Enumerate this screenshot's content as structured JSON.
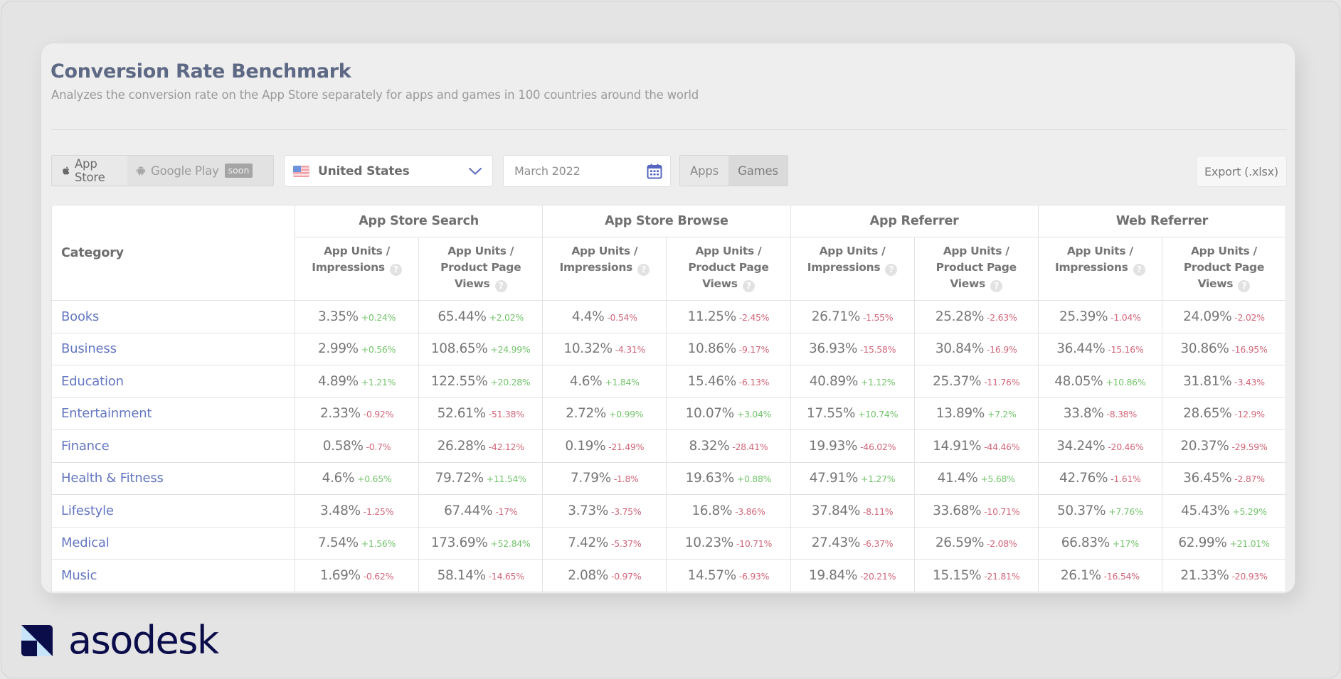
{
  "header": {
    "title": "Conversion Rate Benchmark",
    "subtitle": "Analyzes the conversion rate on the App Store separately for apps and games in 100 countries around the world"
  },
  "controls": {
    "store_options": [
      {
        "label": "App Store",
        "icon": "apple-icon",
        "active": true
      },
      {
        "label": "Google Play",
        "icon": "android-icon",
        "active": false,
        "badge": "soon"
      }
    ],
    "country": {
      "label": "United States",
      "flag": "us-flag-icon"
    },
    "date": {
      "value": "March 2022",
      "icon": "calendar-icon"
    },
    "type_options": [
      {
        "label": "Apps",
        "active": true
      },
      {
        "label": "Games",
        "active": false
      }
    ],
    "export_label": "Export (.xlsx)"
  },
  "table": {
    "category_header": "Category",
    "groups": [
      "App Store Search",
      "App Store Browse",
      "App Referrer",
      "Web Referrer"
    ],
    "sub_headers": {
      "impressions": [
        "App Units /",
        "Impressions"
      ],
      "ppv": [
        "App Units /",
        "Product Page",
        "Views"
      ]
    },
    "help_glyph": "?",
    "rows": [
      {
        "category": "Books",
        "cells": [
          {
            "v": "3.35%",
            "d": "+0.24%"
          },
          {
            "v": "65.44%",
            "d": "+2.02%"
          },
          {
            "v": "4.4%",
            "d": "-0.54%"
          },
          {
            "v": "11.25%",
            "d": "-2.45%"
          },
          {
            "v": "26.71%",
            "d": "-1.55%"
          },
          {
            "v": "25.28%",
            "d": "-2.63%"
          },
          {
            "v": "25.39%",
            "d": "-1.04%"
          },
          {
            "v": "24.09%",
            "d": "-2.02%"
          }
        ]
      },
      {
        "category": "Business",
        "cells": [
          {
            "v": "2.99%",
            "d": "+0.56%"
          },
          {
            "v": "108.65%",
            "d": "+24.99%"
          },
          {
            "v": "10.32%",
            "d": "-4.31%"
          },
          {
            "v": "10.86%",
            "d": "-9.17%"
          },
          {
            "v": "36.93%",
            "d": "-15.58%"
          },
          {
            "v": "30.84%",
            "d": "-16.9%"
          },
          {
            "v": "36.44%",
            "d": "-15.16%"
          },
          {
            "v": "30.86%",
            "d": "-16.95%"
          }
        ]
      },
      {
        "category": "Education",
        "cells": [
          {
            "v": "4.89%",
            "d": "+1.21%"
          },
          {
            "v": "122.55%",
            "d": "+20.28%"
          },
          {
            "v": "4.6%",
            "d": "+1.84%"
          },
          {
            "v": "15.46%",
            "d": "-6.13%"
          },
          {
            "v": "40.89%",
            "d": "+1.12%"
          },
          {
            "v": "25.37%",
            "d": "-11.76%"
          },
          {
            "v": "48.05%",
            "d": "+10.86%"
          },
          {
            "v": "31.81%",
            "d": "-3.43%"
          }
        ]
      },
      {
        "category": "Entertainment",
        "cells": [
          {
            "v": "2.33%",
            "d": "-0.92%"
          },
          {
            "v": "52.61%",
            "d": "-51.38%"
          },
          {
            "v": "2.72%",
            "d": "+0.99%"
          },
          {
            "v": "10.07%",
            "d": "+3.04%"
          },
          {
            "v": "17.55%",
            "d": "+10.74%"
          },
          {
            "v": "13.89%",
            "d": "+7.2%"
          },
          {
            "v": "33.8%",
            "d": "-8.38%"
          },
          {
            "v": "28.65%",
            "d": "-12.9%"
          }
        ]
      },
      {
        "category": "Finance",
        "cells": [
          {
            "v": "0.58%",
            "d": "-0.7%"
          },
          {
            "v": "26.28%",
            "d": "-42.12%"
          },
          {
            "v": "0.19%",
            "d": "-21.49%"
          },
          {
            "v": "8.32%",
            "d": "-28.41%"
          },
          {
            "v": "19.93%",
            "d": "-46.02%"
          },
          {
            "v": "14.91%",
            "d": "-44.46%"
          },
          {
            "v": "34.24%",
            "d": "-20.46%"
          },
          {
            "v": "20.37%",
            "d": "-29.59%"
          }
        ]
      },
      {
        "category": "Health & Fitness",
        "cells": [
          {
            "v": "4.6%",
            "d": "+0.65%"
          },
          {
            "v": "79.72%",
            "d": "+11.54%"
          },
          {
            "v": "7.79%",
            "d": "-1.8%"
          },
          {
            "v": "19.63%",
            "d": "+0.88%"
          },
          {
            "v": "47.91%",
            "d": "+1.27%"
          },
          {
            "v": "41.4%",
            "d": "+5.68%"
          },
          {
            "v": "42.76%",
            "d": "-1.61%"
          },
          {
            "v": "36.45%",
            "d": "-2.87%"
          }
        ]
      },
      {
        "category": "Lifestyle",
        "cells": [
          {
            "v": "3.48%",
            "d": "-1.25%"
          },
          {
            "v": "67.44%",
            "d": "-17%"
          },
          {
            "v": "3.73%",
            "d": "-3.75%"
          },
          {
            "v": "16.8%",
            "d": "-3.86%"
          },
          {
            "v": "37.84%",
            "d": "-8.11%"
          },
          {
            "v": "33.68%",
            "d": "-10.71%"
          },
          {
            "v": "50.37%",
            "d": "+7.76%"
          },
          {
            "v": "45.43%",
            "d": "+5.29%"
          }
        ]
      },
      {
        "category": "Medical",
        "cells": [
          {
            "v": "7.54%",
            "d": "+1.56%"
          },
          {
            "v": "173.69%",
            "d": "+52.84%"
          },
          {
            "v": "7.42%",
            "d": "-5.37%"
          },
          {
            "v": "10.23%",
            "d": "-10.71%"
          },
          {
            "v": "27.43%",
            "d": "-6.37%"
          },
          {
            "v": "26.59%",
            "d": "-2.08%"
          },
          {
            "v": "66.83%",
            "d": "+17%"
          },
          {
            "v": "62.99%",
            "d": "+21.01%"
          }
        ]
      },
      {
        "category": "Music",
        "cells": [
          {
            "v": "1.69%",
            "d": "-0.62%"
          },
          {
            "v": "58.14%",
            "d": "-14.65%"
          },
          {
            "v": "2.08%",
            "d": "-0.97%"
          },
          {
            "v": "14.57%",
            "d": "-6.93%"
          },
          {
            "v": "19.84%",
            "d": "-20.21%"
          },
          {
            "v": "15.15%",
            "d": "-21.81%"
          },
          {
            "v": "26.1%",
            "d": "-16.54%"
          },
          {
            "v": "21.33%",
            "d": "-20.93%"
          }
        ]
      }
    ]
  },
  "colors": {
    "positive": "#74c46c",
    "negative": "#d2677a",
    "category_link": "#6477c2",
    "title": "#5d6984",
    "brand": "#0b0c4a"
  },
  "branding": {
    "logo_text": "asodesk"
  }
}
